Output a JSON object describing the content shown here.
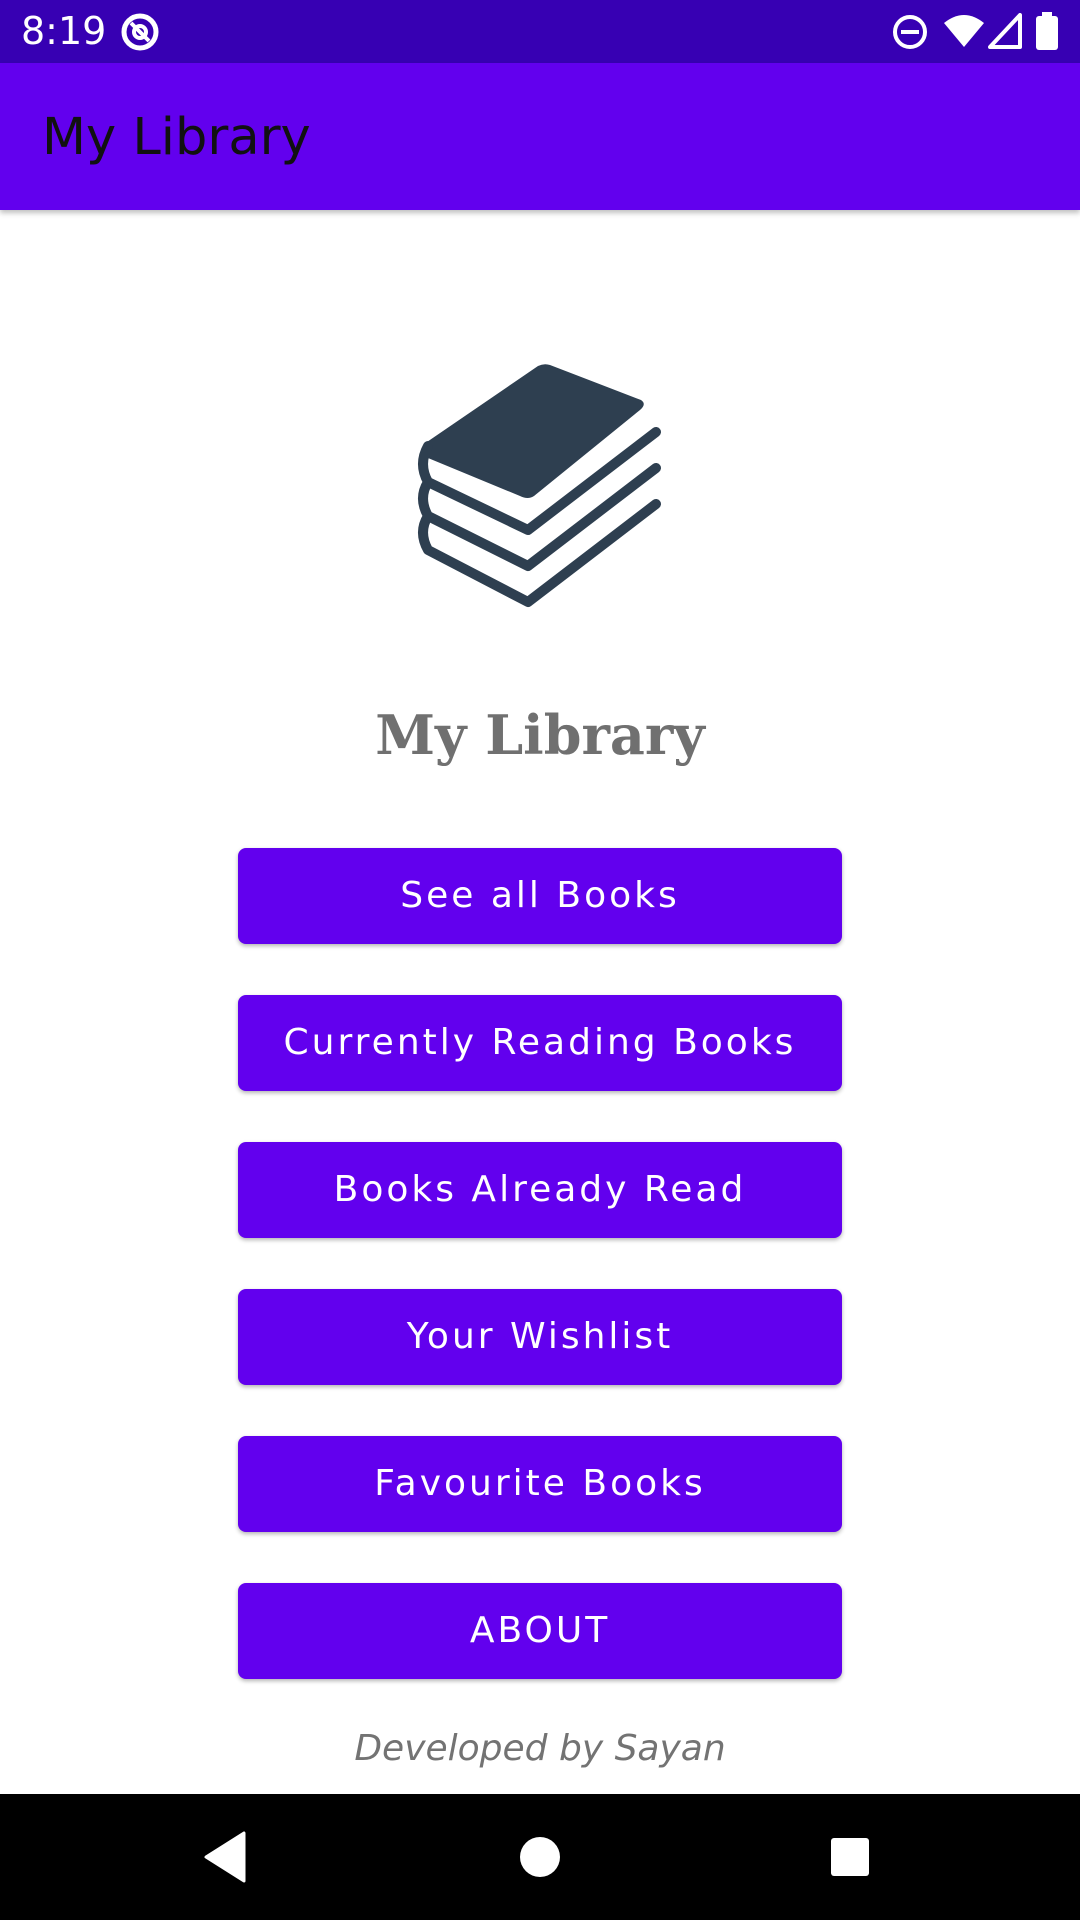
{
  "status_bar": {
    "time": "8:19"
  },
  "app_bar": {
    "title": "My Library"
  },
  "main": {
    "brand_title": "My Library",
    "buttons": [
      {
        "label": "See all Books"
      },
      {
        "label": "Currently Reading Books"
      },
      {
        "label": "Books Already Read"
      },
      {
        "label": "Your Wishlist"
      },
      {
        "label": "Favourite Books"
      },
      {
        "label": "ABOUT"
      }
    ],
    "footer": "Developed by Sayan"
  },
  "icons": {
    "logo": "books-stack-icon",
    "status_left": "at-sign-icon",
    "status_right": [
      "do-not-disturb-icon",
      "wifi-icon",
      "signal-icon",
      "battery-icon"
    ],
    "nav": [
      "back-icon",
      "home-icon",
      "recents-icon"
    ]
  },
  "colors": {
    "status_bar": "#3700B3",
    "primary": "#6200EE",
    "logo": "#2E3F50",
    "nav_bar": "#000000"
  }
}
